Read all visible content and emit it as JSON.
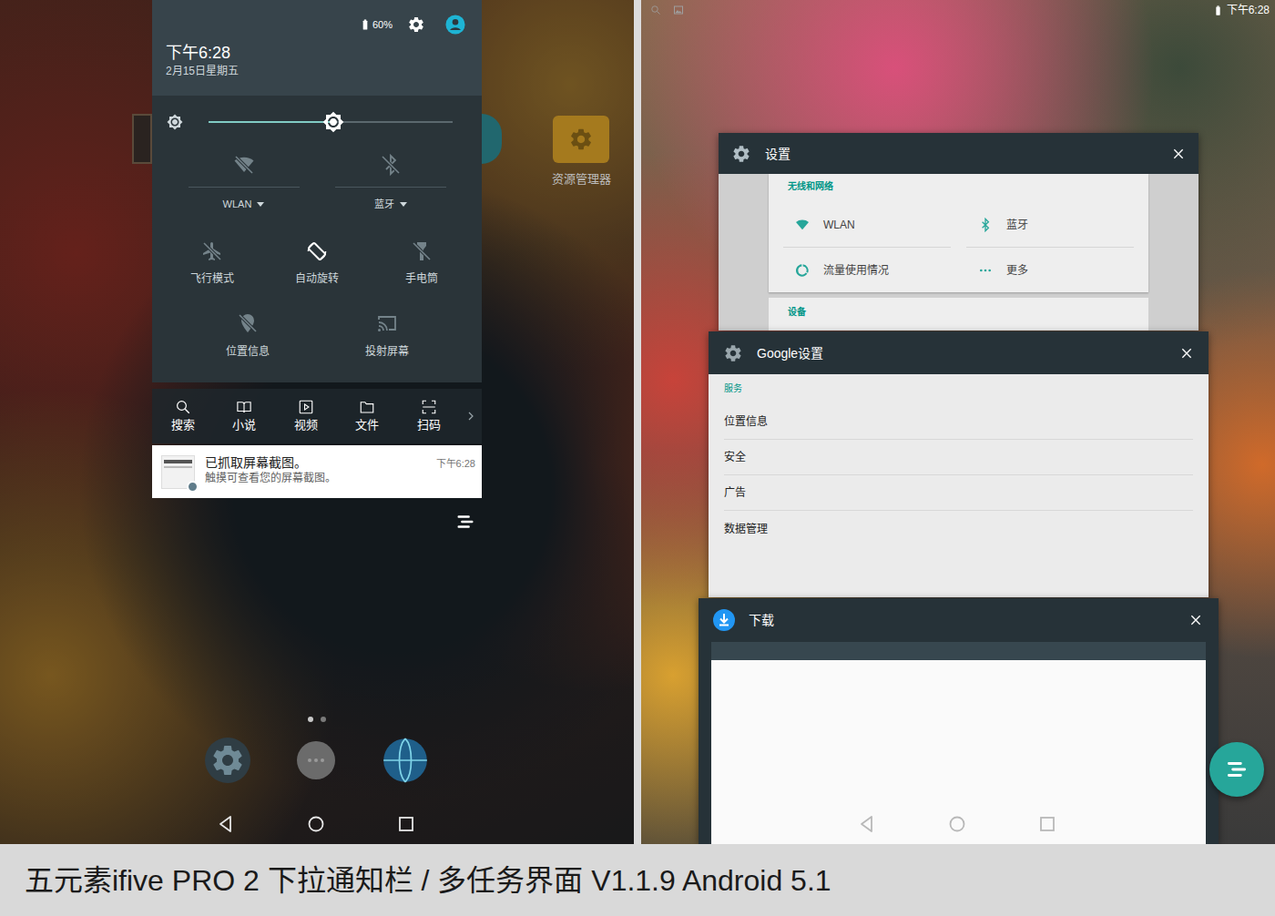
{
  "caption": "五元素ifive PRO 2 下拉通知栏 / 多任务界面 V1.1.9 Android 5.1",
  "notification_shade": {
    "home": {
      "apps": [
        {
          "label": "资源管理器"
        }
      ],
      "pages": [
        {
          "selected": true
        },
        {
          "selected": false
        }
      ]
    },
    "header": {
      "battery": "60%",
      "time": "下午6:28",
      "date": "2月15日星期五"
    },
    "brightness": {
      "level": 0.51
    },
    "tiles": [
      {
        "label": "WLAN",
        "kind": "dropdown",
        "on": false
      },
      {
        "label": "蓝牙",
        "kind": "dropdown",
        "on": false
      },
      {
        "label": "飞行模式",
        "kind": "toggle",
        "on": false
      },
      {
        "label": "自动旋转",
        "kind": "toggle",
        "on": true
      },
      {
        "label": "手电筒",
        "kind": "toggle",
        "on": false
      },
      {
        "label": "位置信息",
        "kind": "toggle",
        "on": false
      },
      {
        "label": "投射屏幕",
        "kind": "toggle",
        "on": false
      }
    ],
    "shortcuts": [
      {
        "label": "搜索"
      },
      {
        "label": "小说"
      },
      {
        "label": "视频"
      },
      {
        "label": "文件"
      },
      {
        "label": "扫码"
      }
    ],
    "notifications": [
      {
        "title": "已抓取屏幕截图。",
        "text": "触摸可查看您的屏幕截图。",
        "time": "下午6:28"
      }
    ]
  },
  "recents": {
    "status_bar": {
      "time": "下午6:28"
    },
    "cards": [
      {
        "title": "设置",
        "kind": "settings",
        "sections": [
          {
            "header": "无线和网络",
            "items": [
              "WLAN",
              "蓝牙",
              "流量使用情况",
              "更多"
            ]
          },
          {
            "header": "设备",
            "items": []
          }
        ]
      },
      {
        "title": "Google设置",
        "kind": "list",
        "header": "服务",
        "items": [
          "位置信息",
          "安全",
          "广告",
          "数据管理"
        ]
      },
      {
        "title": "下载",
        "kind": "blank"
      }
    ]
  }
}
